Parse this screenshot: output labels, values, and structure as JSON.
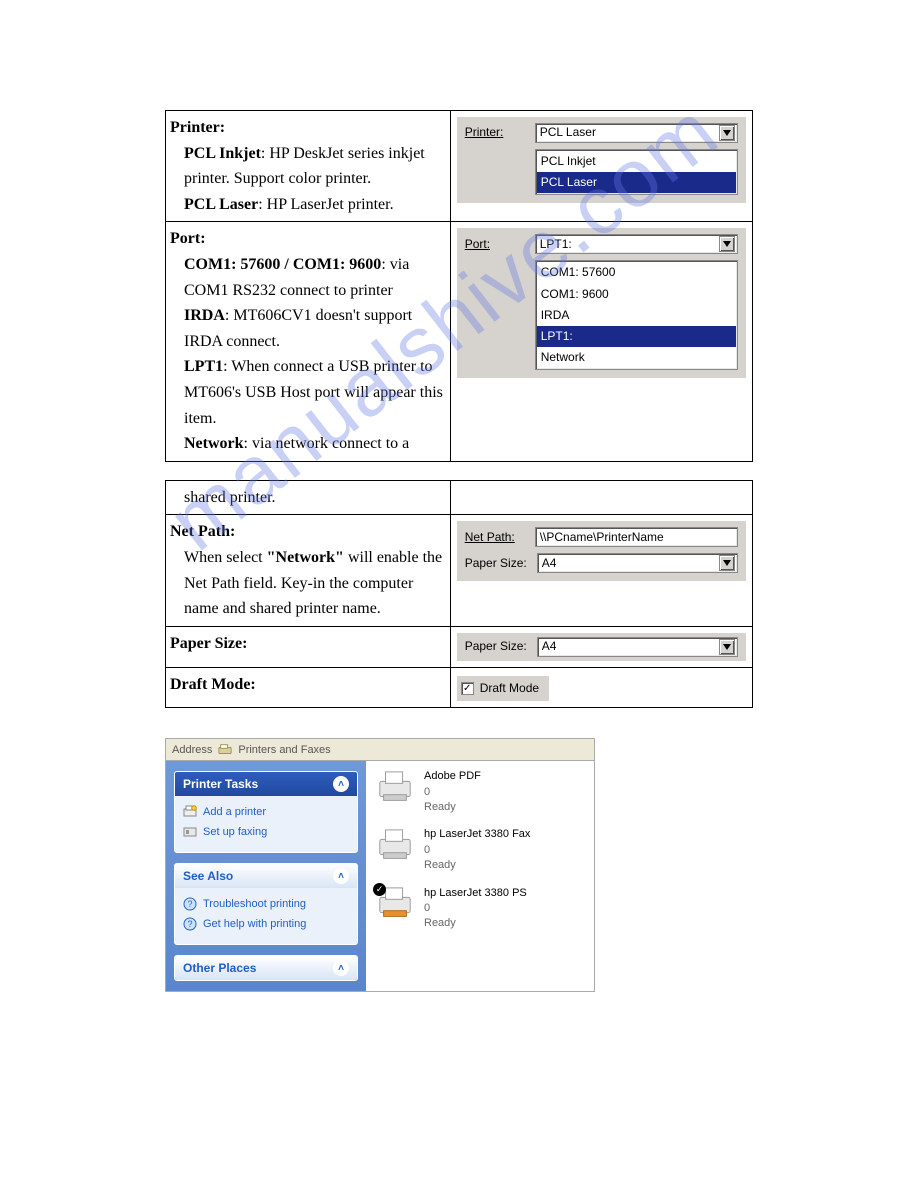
{
  "watermark": "manualshive.com",
  "rows": {
    "printer": {
      "heading": "Printer:",
      "bullets": [
        {
          "b": "PCL Inkjet",
          "t": ": HP DeskJet series inkjet printer. Support color printer."
        },
        {
          "b": "PCL Laser",
          "t": ": HP LaserJet printer."
        }
      ],
      "ctl": {
        "label": "Printer:",
        "selected": "PCL Laser",
        "options": [
          "PCL Inkjet",
          "PCL Laser"
        ],
        "highlight": "PCL Laser"
      }
    },
    "port": {
      "heading": "Port:",
      "bullets": [
        {
          "b": "COM1: 57600 / COM1: 9600",
          "t": ": via COM1 RS232 connect to printer"
        },
        {
          "b": "IRDA",
          "t": ": MT606CV1 doesn't support IRDA connect."
        },
        {
          "b": "LPT1",
          "t": ": When connect a USB printer to MT606's USB Host port will appear this item."
        },
        {
          "b": "Network",
          "t": ": via network connect to a"
        }
      ],
      "ctl": {
        "label": "Port:",
        "selected": "LPT1:",
        "options": [
          "COM1: 57600",
          "COM1: 9600",
          "IRDA",
          "LPT1:",
          "Network"
        ],
        "highlight": "LPT1:"
      }
    },
    "shared": "shared printer.",
    "netpath": {
      "heading": "Net Path:",
      "text": "When select \"Network\" will enable the Net Path field. Key-in the computer name and shared printer name.",
      "labels": {
        "net": "Net Path:",
        "paper": "Paper Size:"
      },
      "net_value": "\\\\PCname\\PrinterName",
      "paper_value": "A4"
    },
    "paper": {
      "heading": "Paper Size:",
      "label": "Paper Size:",
      "value": "A4"
    },
    "draft": {
      "heading": "Draft Mode:",
      "label": "Draft Mode",
      "checked": true
    }
  },
  "xp": {
    "address_label": "Address",
    "address_value": "Printers and Faxes",
    "tasks": {
      "title": "Printer Tasks",
      "items": [
        "Add a printer",
        "Set up faxing"
      ]
    },
    "seealso": {
      "title": "See Also",
      "items": [
        "Troubleshoot printing",
        "Get help with printing"
      ]
    },
    "other": {
      "title": "Other Places"
    },
    "printers": [
      {
        "name": "Adobe PDF",
        "jobs": "0",
        "status": "Ready",
        "default": false
      },
      {
        "name": "hp LaserJet 3380 Fax",
        "jobs": "0",
        "status": "Ready",
        "default": false
      },
      {
        "name": "hp LaserJet 3380 PS",
        "jobs": "0",
        "status": "Ready",
        "default": true
      }
    ]
  }
}
